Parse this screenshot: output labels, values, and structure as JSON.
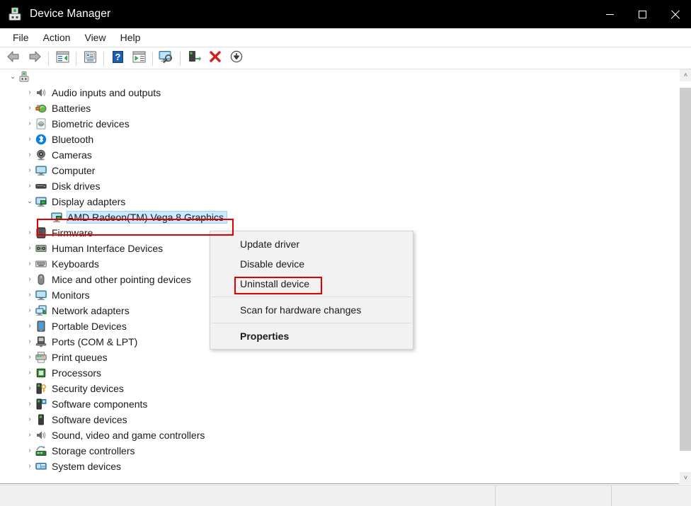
{
  "window": {
    "title": "Device Manager",
    "icon": "device-manager-icon",
    "controls": {
      "minimize": "Minimize",
      "maximize": "Maximize",
      "close": "Close"
    }
  },
  "menubar": {
    "items": [
      {
        "label": "File",
        "name": "menu-file"
      },
      {
        "label": "Action",
        "name": "menu-action"
      },
      {
        "label": "View",
        "name": "menu-view"
      },
      {
        "label": "Help",
        "name": "menu-help"
      }
    ]
  },
  "toolbar": {
    "buttons": [
      {
        "name": "back-icon",
        "title": "Back"
      },
      {
        "name": "forward-icon",
        "title": "Forward"
      },
      {
        "name": "show-hide-console-tree-icon",
        "title": "Show/Hide Console Tree"
      },
      {
        "name": "properties-icon",
        "title": "Properties"
      },
      {
        "name": "help-icon",
        "title": "Help"
      },
      {
        "name": "show-hide-action-pane-icon",
        "title": "Show/Hide Action Pane"
      },
      {
        "name": "scan-for-hardware-changes-icon",
        "title": "Scan for hardware changes"
      },
      {
        "name": "update-driver-icon",
        "title": "Update driver"
      },
      {
        "name": "uninstall-device-icon",
        "title": "Uninstall device"
      },
      {
        "name": "disable-device-icon",
        "title": "Disable device"
      }
    ]
  },
  "tree": {
    "root": {
      "label": "",
      "icon": "computer-root-icon",
      "expanded": true
    },
    "items": [
      {
        "label": "Audio inputs and outputs",
        "icon": "speaker-icon",
        "expanded": false,
        "selected": false
      },
      {
        "label": "Batteries",
        "icon": "battery-icon",
        "expanded": false,
        "selected": false
      },
      {
        "label": "Biometric devices",
        "icon": "fingerprint-icon",
        "expanded": false,
        "selected": false
      },
      {
        "label": "Bluetooth",
        "icon": "bluetooth-icon",
        "expanded": false,
        "selected": false
      },
      {
        "label": "Cameras",
        "icon": "camera-icon",
        "expanded": false,
        "selected": false
      },
      {
        "label": "Computer",
        "icon": "monitor-icon",
        "expanded": false,
        "selected": false
      },
      {
        "label": "Disk drives",
        "icon": "disk-drive-icon",
        "expanded": false,
        "selected": false
      },
      {
        "label": "Display adapters",
        "icon": "display-adapter-icon",
        "expanded": true,
        "selected": false
      },
      {
        "label": "AMD Radeon(TM) Vega 8 Graphics",
        "icon": "display-adapter-icon",
        "expanded": null,
        "selected": true,
        "child": true
      },
      {
        "label": "Firmware",
        "icon": "firmware-icon",
        "expanded": false,
        "selected": false
      },
      {
        "label": "Human Interface Devices",
        "icon": "hid-icon",
        "expanded": false,
        "selected": false
      },
      {
        "label": "Keyboards",
        "icon": "keyboard-icon",
        "expanded": false,
        "selected": false
      },
      {
        "label": "Mice and other pointing devices",
        "icon": "mouse-icon",
        "expanded": false,
        "selected": false
      },
      {
        "label": "Monitors",
        "icon": "monitor-icon",
        "expanded": false,
        "selected": false
      },
      {
        "label": "Network adapters",
        "icon": "network-adapter-icon",
        "expanded": false,
        "selected": false
      },
      {
        "label": "Portable Devices",
        "icon": "portable-device-icon",
        "expanded": false,
        "selected": false
      },
      {
        "label": "Ports (COM & LPT)",
        "icon": "port-icon",
        "expanded": false,
        "selected": false
      },
      {
        "label": "Print queues",
        "icon": "printer-icon",
        "expanded": false,
        "selected": false
      },
      {
        "label": "Processors",
        "icon": "processor-icon",
        "expanded": false,
        "selected": false
      },
      {
        "label": "Security devices",
        "icon": "security-device-icon",
        "expanded": false,
        "selected": false
      },
      {
        "label": "Software components",
        "icon": "software-component-icon",
        "expanded": false,
        "selected": false
      },
      {
        "label": "Software devices",
        "icon": "software-device-icon",
        "expanded": false,
        "selected": false
      },
      {
        "label": "Sound, video and game controllers",
        "icon": "speaker-icon",
        "expanded": false,
        "selected": false
      },
      {
        "label": "Storage controllers",
        "icon": "storage-controller-icon",
        "expanded": false,
        "selected": false
      },
      {
        "label": "System devices",
        "icon": "system-device-icon",
        "expanded": false,
        "selected": false
      }
    ],
    "expand_glyph": "›",
    "collapse_glyph": "⌄"
  },
  "context_menu": {
    "items": [
      {
        "label": "Update driver",
        "name": "context-menu-update-driver",
        "bold": false,
        "separator_after": false
      },
      {
        "label": "Disable device",
        "name": "context-menu-disable-device",
        "bold": false,
        "separator_after": false
      },
      {
        "label": "Uninstall device",
        "name": "context-menu-uninstall-device",
        "bold": false,
        "separator_after": true
      },
      {
        "label": "Scan for hardware changes",
        "name": "context-menu-scan-for-hardware-changes",
        "bold": false,
        "separator_after": true
      },
      {
        "label": "Properties",
        "name": "context-menu-properties",
        "bold": true,
        "separator_after": false
      }
    ]
  },
  "statusbar": {
    "pane1": "",
    "pane2": "",
    "pane3": ""
  },
  "scrollbar": {
    "up_glyph": "˄",
    "down_glyph": "˅"
  },
  "annotations": {
    "highlight_color": "#e00000",
    "selection_color": "#cce8ff",
    "boxes": [
      {
        "name": "annotation-box-selected-device",
        "target": "AMD Radeon(TM) Vega 8 Graphics"
      },
      {
        "name": "annotation-box-uninstall-device",
        "target": "Uninstall device"
      }
    ]
  }
}
